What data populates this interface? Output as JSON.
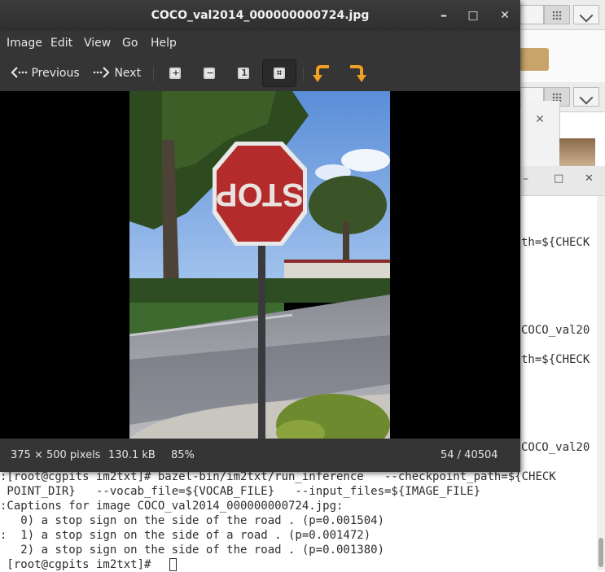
{
  "viewer": {
    "title": "COCO_val2014_000000000724.jpg",
    "window_buttons": {
      "minimize": "–",
      "maximize": "□",
      "close": "✕"
    },
    "menu": [
      "Image",
      "Edit",
      "View",
      "Go",
      "Help"
    ],
    "toolbar": {
      "previous": "Previous",
      "next": "Next"
    },
    "status": {
      "dimensions": "375 × 500 pixels",
      "size": "130.1 kB",
      "zoom": "85%",
      "position": "54 / 40504"
    },
    "accent": "#f0a020"
  },
  "background": {
    "dialog_close": "✕",
    "terminal_window_buttons": {
      "minimize": "–",
      "maximize": "□",
      "close": "✕"
    },
    "right_fragments": [
      "th=${CHECK",
      "COCO_val20",
      "th=${CHECK",
      "COCO_val20"
    ]
  },
  "terminal": {
    "lines": [
      ":[root@cgpits im2txt]# bazel-bin/im2txt/run_inference   --checkpoint_path=${CHECK",
      " POINT_DIR}   --vocab_file=${VOCAB_FILE}   --input_files=${IMAGE_FILE}",
      ":Captions for image COCO_val2014_000000000724.jpg:",
      "   0) a stop sign on the side of the road . (p=0.001504)",
      ":  1) a stop sign on the side of a road . (p=0.001472)",
      "   2) a stop sign on the side of the road . (p=0.001380)",
      " [root@cgpits im2txt]# "
    ]
  },
  "photo": {
    "sign_text": "STOP"
  }
}
